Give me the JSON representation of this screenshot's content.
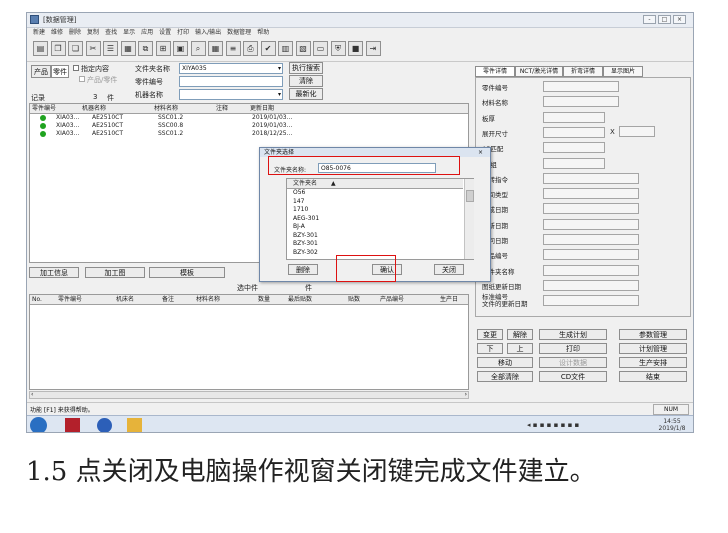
{
  "window": {
    "title": "[数据管理]",
    "controls": [
      "-",
      "□",
      "×"
    ]
  },
  "menu": [
    "新建",
    "维修",
    "删除",
    "复制",
    "查找",
    "显示",
    "应用",
    "设置",
    "打印",
    "输入/输出",
    "数据管理",
    "帮助"
  ],
  "toolbar_icons": [
    "folder-icon",
    "copy-icon",
    "paste-icon",
    "cut-icon",
    "list-icon",
    "table-icon",
    "merge-icon",
    "graph-icon",
    "cart-icon",
    "binoculars-icon",
    "grid-icon",
    "text-icon",
    "printer-icon",
    "check-icon",
    "chart-icon",
    "chart2-icon",
    "monitor-icon",
    "shield-icon",
    "stop-icon",
    "exit-icon"
  ],
  "filter": {
    "product_tab": "产品",
    "part_tab": "零件",
    "specify_check": "指定内容",
    "product_part_check": "产品/零件",
    "folder_label": "文件夹名称",
    "folder_value": "XIYA035",
    "part_no_label": "零件编号",
    "machine_label": "机器名称",
    "execute_button": "执行搜索",
    "clear_button": "清除",
    "latest_button": "最新化"
  },
  "records": {
    "label": "记录",
    "count": "3",
    "unit": "件"
  },
  "parts_table": {
    "headers": [
      "零件编号",
      "机器名称",
      "材料名称",
      "注释",
      "更新日期"
    ],
    "rows": [
      [
        "XIA03...",
        "AE2510CT",
        "SSC01.2",
        "",
        "2019/01/03..."
      ],
      [
        "XIA03...",
        "AE2510CT",
        "SSC00.8",
        "",
        "2019/01/03..."
      ],
      [
        "XIA03...",
        "AE2510CT",
        "SSC01.2",
        "",
        "2018/12/25..."
      ]
    ]
  },
  "mid_buttons": {
    "process_info": "加工信息",
    "process_diagram": "加工图",
    "template": "模板"
  },
  "selected": {
    "title": "选中件",
    "suffix": "件"
  },
  "selected_table": {
    "headers": [
      "No.",
      "零件编号",
      "机床名",
      "备注",
      "材料名称",
      "数量",
      "最后贴数",
      "贴数",
      "产品编号",
      "生产日"
    ]
  },
  "dialog": {
    "title": "文件夹选择",
    "name_label": "文件夹名称:",
    "name_value": "O85-0076",
    "list_header": "文件夹名",
    "items": [
      "O56",
      "147",
      "1710",
      "AEG-301",
      "BJ-A",
      "BZY-301",
      "BZY-301",
      "BZY-302"
    ],
    "buttons": {
      "delete": "删除",
      "confirm": "确认",
      "close": "关闭"
    }
  },
  "right_tabs": [
    "零件详情",
    "NCT/激光详情",
    "折弯详情",
    "显示图片"
  ],
  "detail_labels": [
    "零件编号",
    "材料名称",
    "板厚",
    "展开尺寸",
    "AP匹配",
    "AP组",
    "旋转指令",
    "中间类型",
    "生成日期",
    "更新日期",
    "访问日期",
    "产品编号",
    "文件夹名称",
    "图纸更新日期",
    "标准编号\n文件的更新日期"
  ],
  "size_sep": "X",
  "action_buttons": [
    "变更",
    "解除",
    "生成计划",
    "参数管理",
    "下",
    "上",
    "打印",
    "计划管理",
    "移动",
    "设计数据",
    "生产安排",
    "全部清除",
    "CD文件",
    "结束"
  ],
  "status": {
    "left": "功能 [F1] 来获得帮助。",
    "num": "NUM"
  },
  "taskbar": {
    "tray_time": "14:55",
    "tray_date": "2019/1/8"
  },
  "caption": "1.5 点关闭及电脑操作视窗关闭键完成文件建立。"
}
